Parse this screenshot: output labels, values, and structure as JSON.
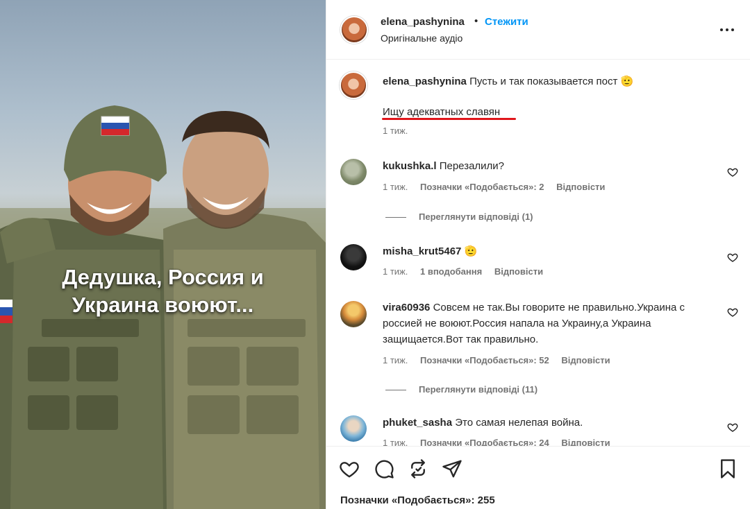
{
  "media": {
    "caption_line1": "Дедушка, Россия и",
    "caption_line2": "Украина воюют..."
  },
  "header": {
    "username": "elena_pashynina",
    "separator": "•",
    "follow_label": "Стежити",
    "audio_label": "Оригінальне аудіо"
  },
  "post": {
    "username": "elena_pashynina",
    "caption": "Пусть и так показывается пост",
    "emoji": "🫡",
    "line2": "Ищу адекватных славян",
    "time": "1 тиж."
  },
  "comments": [
    {
      "username": "kukushka.l",
      "text": "Перезалили?",
      "time": "1 тиж.",
      "likes": "Позначки «Подобається»: 2",
      "reply": "Відповісти",
      "view_replies": "Переглянути відповіді (1)"
    },
    {
      "username": "misha_krut5467",
      "text": "🫡",
      "time": "1 тиж.",
      "likes": "1 вподобання",
      "reply": "Відповісти"
    },
    {
      "username": "vira60936",
      "text": "Совсем не так.Вы говорите не правильно.Украина с россией не воюют.Россия напала на Украину,а Украина защищается.Вот так правильно.",
      "time": "1 тиж.",
      "likes": "Позначки «Подобається»: 52",
      "reply": "Відповісти",
      "view_replies": "Переглянути відповіді (11)"
    },
    {
      "username": "phuket_sasha",
      "text": "Это самая нелепая война.",
      "time": "1 тиж.",
      "likes": "Позначки «Подобається»: 24",
      "reply": "Відповісти"
    }
  ],
  "footer": {
    "likes_label": "Позначки «Подобається»: 255"
  },
  "colors": {
    "accent": "#0095f6",
    "underline": "#e0161b",
    "text": "#262626",
    "muted": "#737373"
  },
  "icons": [
    "more-icon",
    "heart-icon",
    "comment-icon",
    "repost-icon",
    "share-icon",
    "bookmark-icon"
  ]
}
